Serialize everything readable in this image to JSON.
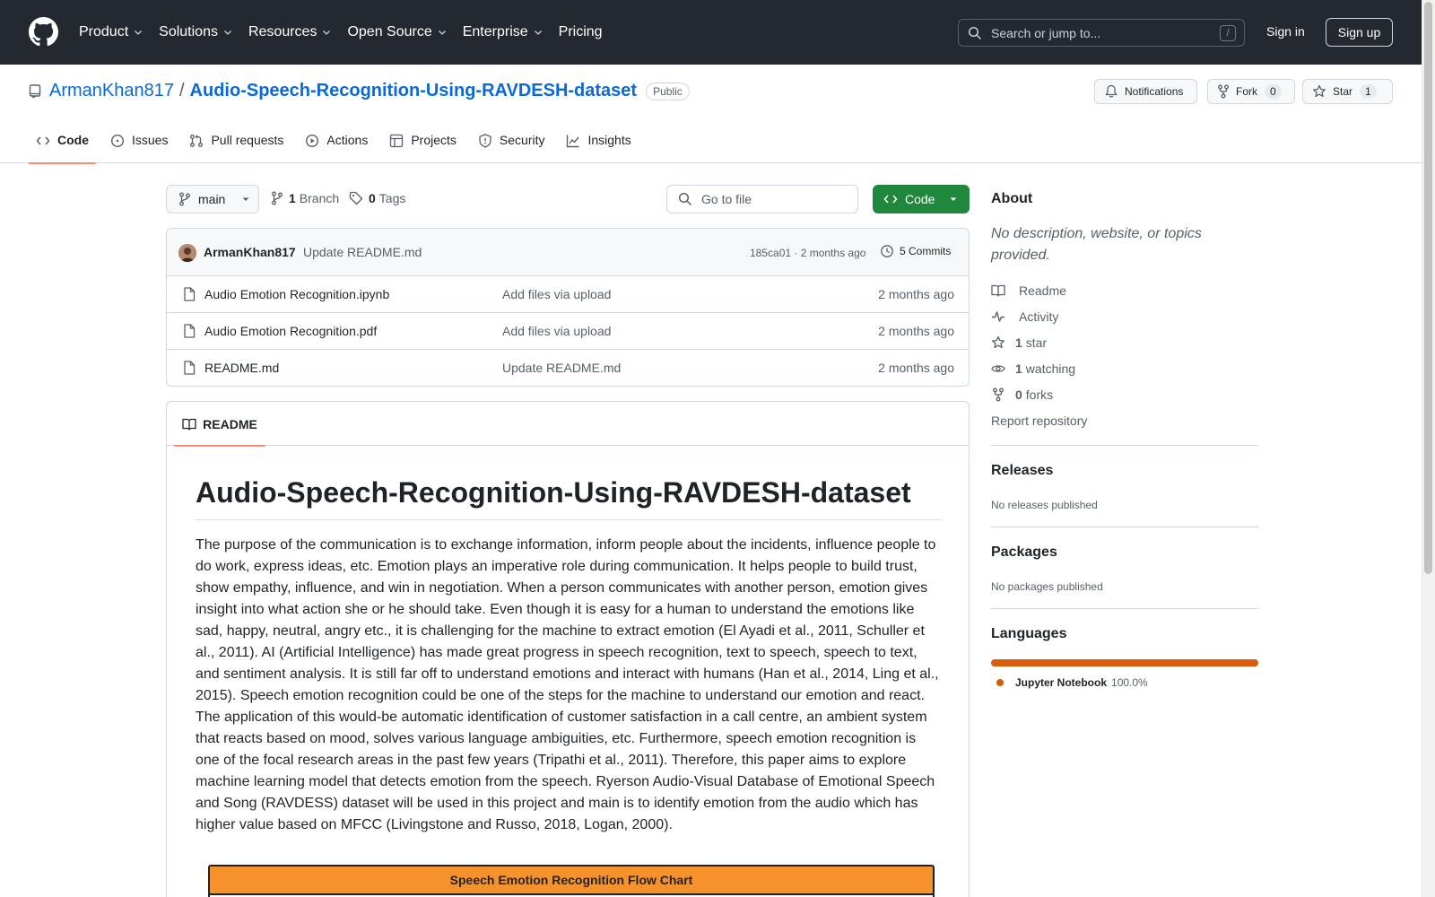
{
  "header": {
    "nav": [
      {
        "label": "Product",
        "dropdown": true
      },
      {
        "label": "Solutions",
        "dropdown": true
      },
      {
        "label": "Resources",
        "dropdown": true
      },
      {
        "label": "Open Source",
        "dropdown": true
      },
      {
        "label": "Enterprise",
        "dropdown": true
      },
      {
        "label": "Pricing",
        "dropdown": false
      }
    ],
    "search_placeholder": "Search or jump to...",
    "search_shortcut": "/",
    "signin": "Sign in",
    "signup": "Sign up"
  },
  "repo": {
    "owner": "ArmanKhan817",
    "separator": "/",
    "name": "Audio-Speech-Recognition-Using-RAVDESH-dataset",
    "visibility": "Public",
    "notifications_label": "Notifications",
    "fork_label": "Fork",
    "fork_count": "0",
    "star_label": "Star",
    "star_count": "1"
  },
  "tabs": [
    {
      "label": "Code",
      "icon": "code-icon",
      "active": true
    },
    {
      "label": "Issues",
      "icon": "issue-icon",
      "active": false
    },
    {
      "label": "Pull requests",
      "icon": "pull-request-icon",
      "active": false
    },
    {
      "label": "Actions",
      "icon": "play-icon",
      "active": false
    },
    {
      "label": "Projects",
      "icon": "table-icon",
      "active": false
    },
    {
      "label": "Security",
      "icon": "shield-icon",
      "active": false
    },
    {
      "label": "Insights",
      "icon": "graph-icon",
      "active": false
    }
  ],
  "branchbar": {
    "branch": "main",
    "branch_count": "1",
    "branch_label": "Branch",
    "tag_count": "0",
    "tag_label": "Tags",
    "goto_placeholder": "Go to file",
    "code_button": "Code"
  },
  "commit": {
    "author": "ArmanKhan817",
    "message": "Update README.md",
    "meta": "185ca01 · 2 months ago",
    "commits_label": "5 Commits"
  },
  "files": [
    {
      "name": "Audio Emotion Recognition.ipynb",
      "message": "Add files via upload",
      "time": "2 months ago"
    },
    {
      "name": "Audio Emotion Recognition.pdf",
      "message": "Add files via upload",
      "time": "2 months ago"
    },
    {
      "name": "README.md",
      "message": "Update README.md",
      "time": "2 months ago"
    }
  ],
  "readme": {
    "tab_label": "README",
    "title": "Audio-Speech-Recognition-Using-RAVDESH-dataset",
    "paragraph": "The purpose of the communication is to exchange information, inform people about the incidents, influence people to do work, express ideas, etc. Emotion plays an imperative role during communication. It helps people to build trust, show empathy, influence, and win in negotiation. When a person communicates with another person, emotion gives insight into what action she or he should take. Even though it is easy for a human to understand the emotions like sad, happy, neutral, angry etc., it is challenging for the machine to extract emotion (El Ayadi et al., 2011, Schuller et al., 2011). AI (Artificial Intelligence) has made great progress in speech recognition, text to speech, speech to text, and sentiment analysis. It is still far off to understand emotions and interact with humans (Han et al., 2014, Ling et al., 2015). Speech emotion recognition could be one of the steps for the machine to understand our emotion and react. The application of this would-be automatic identification of customer satisfaction in a call centre, an ambient system that reacts based on mood, solves various language ambiguities, etc. Furthermore, speech emotion recognition is one of the focal research areas in the past few years (Tripathi et al., 2011). Therefore, this paper aims to explore machine learning model that detects emotion from the speech. Ryerson Audio-Visual Database of Emotional Speech and Song (RAVDESS) dataset will be used in this project and main is to identify emotion from the audio which has higher value based on MFCC (Livingstone and Russo, 2018, Logan, 2000).",
    "flowchart_title": "Speech Emotion Recognition Flow Chart"
  },
  "sidebar": {
    "about_heading": "About",
    "about_desc": "No description, website, or topics provided.",
    "items": [
      {
        "icon": "book-icon",
        "count": "",
        "label": "Readme"
      },
      {
        "icon": "pulse-icon",
        "count": "",
        "label": "Activity"
      },
      {
        "icon": "star-icon",
        "count": "1",
        "label": "star"
      },
      {
        "icon": "eye-icon",
        "count": "1",
        "label": "watching"
      },
      {
        "icon": "fork-icon",
        "count": "0",
        "label": "forks"
      }
    ],
    "report": "Report repository",
    "releases_heading": "Releases",
    "releases_text": "No releases published",
    "packages_heading": "Packages",
    "packages_text": "No packages published",
    "languages_heading": "Languages",
    "languages": [
      {
        "name": "Jupyter Notebook",
        "percent": "100.0%",
        "color": "#da5b0b"
      }
    ]
  },
  "colors": {
    "header_bg": "#24292f",
    "link": "#0969da",
    "code_button": "#1f883d",
    "tab_underline": "#fd8c73",
    "flowchart": "#f5922b"
  }
}
